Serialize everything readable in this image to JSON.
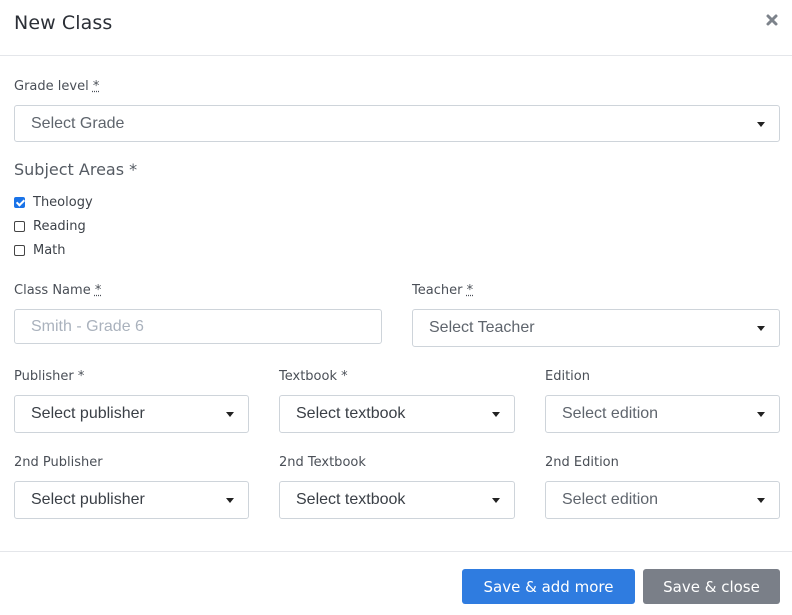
{
  "modal": {
    "title": "New Class"
  },
  "form": {
    "grade_level": {
      "label": "Grade level",
      "required": "*",
      "value": "Select Grade"
    },
    "subject_areas": {
      "label": "Subject Areas *",
      "options": [
        {
          "label": "Theology",
          "checked": true
        },
        {
          "label": "Reading",
          "checked": false
        },
        {
          "label": "Math",
          "checked": false
        }
      ]
    },
    "class_name": {
      "label": "Class Name",
      "required": "*",
      "placeholder": "Smith - Grade 6",
      "value": ""
    },
    "teacher": {
      "label": "Teacher",
      "required": "*",
      "value": "Select Teacher"
    },
    "publisher": {
      "label": "Publisher *",
      "value": "Select publisher"
    },
    "textbook": {
      "label": "Textbook *",
      "value": "Select textbook"
    },
    "edition": {
      "label": "Edition",
      "value": "Select edition"
    },
    "publisher2": {
      "label": "2nd Publisher",
      "value": "Select publisher"
    },
    "textbook2": {
      "label": "2nd Textbook",
      "value": "Select textbook"
    },
    "edition2": {
      "label": "2nd Edition",
      "value": "Select edition"
    }
  },
  "footer": {
    "save_add_label": "Save & add more",
    "save_close_label": "Save & close"
  },
  "colors": {
    "primary": "#2f7ce0",
    "secondary": "#7a7f88",
    "checkbox_checked": "#1a73e8"
  },
  "icons": {
    "close": "close-icon",
    "dropdown": "caret-down-icon",
    "check": "checkmark-icon"
  }
}
